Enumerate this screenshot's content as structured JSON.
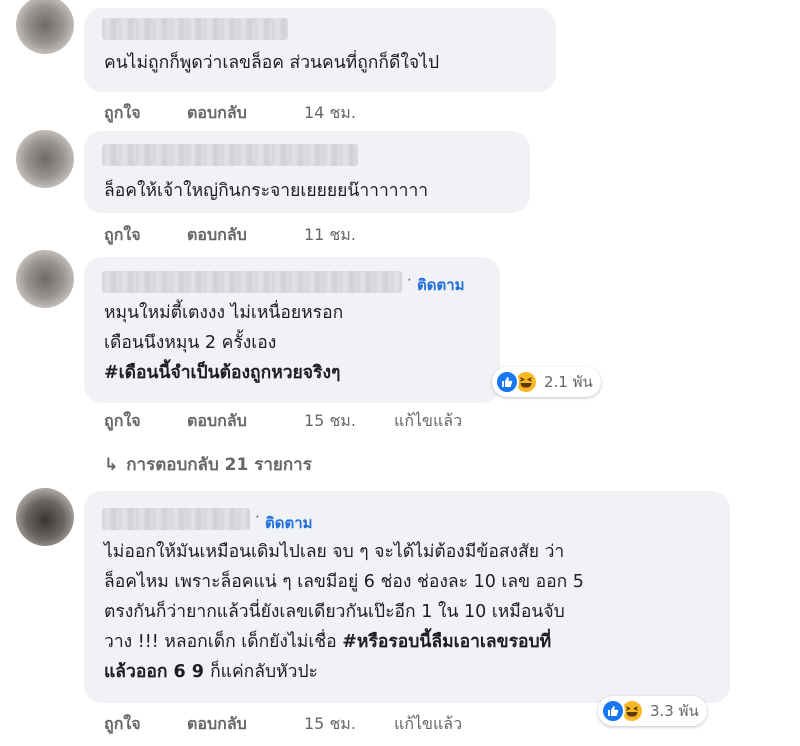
{
  "comments": [
    {
      "text_lines": [
        "คนไม่ถูกก็พูดว่าเลขล็อค ส่วนคนที่ถูกก็ดีใจไป"
      ],
      "actions": {
        "like": "ถูกใจ",
        "reply": "ตอบกลับ",
        "time": "14 ชม."
      }
    },
    {
      "text_lines": [
        "ล็อคให้เจ้าใหญ่กินกระจายเยยยยน๊าาาาาาา"
      ],
      "actions": {
        "like": "ถูกใจ",
        "reply": "ตอบกลับ",
        "time": "11 ชม."
      }
    },
    {
      "follow_label": "ติดตาม",
      "text_lines": [
        "หมุนใหม่ตี้เตงงง ไม่เหนื่อยหรอก",
        "เดือนนึงหมุน 2 ครั้งเอง",
        "#เดือนนี้จำเป็นต้องถูกหวยจริงๆ"
      ],
      "reaction_count": "2.1 พัน",
      "actions": {
        "like": "ถูกใจ",
        "reply": "ตอบกลับ",
        "time": "15 ชม.",
        "edited": "แก้ไขแล้ว"
      },
      "replies_label": "การตอบกลับ 21 รายการ"
    },
    {
      "follow_label": "ติดตาม",
      "text_lines": [
        "ไม่ออกให้มันเหมือนเดิมไปเลย จบ ๆ จะได้ไม่ต้องมีข้อสงสัย ว่า",
        "ล็อคไหม เพราะล็อคแน่ ๆ เลขมีอยู่ 6 ช่อง ช่องละ 10 เลข ออก 5",
        "ตรงกันก็ว่ายากแล้วนี่ยังเลขเดียวกันเป๊ะอีก 1 ใน 10 เหมือนจับ"
      ],
      "line4_plain": "วาง !!! หลอกเด็ก เด็กยังไม่เชื่อ ",
      "line4_bold": "#หรือรอบนี้ลืมเอาเลขรอบที่",
      "line5_bold": "แล้วออก 6 9 ",
      "line5_plain": "ก็แค่กลับหัวปะ",
      "reaction_count": "3.3 พัน",
      "actions": {
        "like": "ถูกใจ",
        "reply": "ตอบกลับ",
        "time": "15 ชม.",
        "edited": "แก้ไขแล้ว"
      }
    }
  ],
  "icons": {
    "like": "like-icon",
    "haha": "haha-icon",
    "reply_arrow": "reply-arrow-icon"
  },
  "colors": {
    "link_blue": "#216fdb",
    "bubble_bg": "#f0f2f5",
    "meta_gray": "#65676b",
    "like_blue": "#1877f2",
    "haha_yellow": "#f7b928"
  }
}
